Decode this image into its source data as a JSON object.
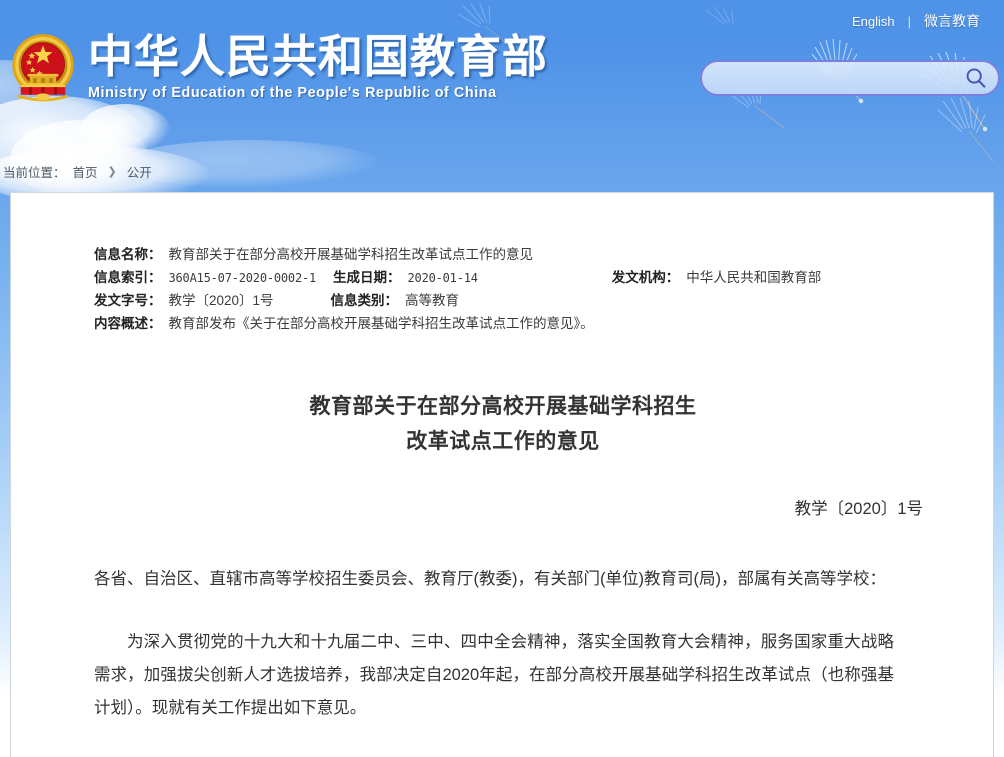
{
  "header": {
    "emblem_icon": "national-emblem-icon",
    "title_cn": "中华人民共和国教育部",
    "title_en": "Ministry of Education of the People's Republic of China",
    "links": [
      {
        "label": "English",
        "name": "english-link"
      },
      {
        "label": "微言教育",
        "name": "weiyan-jiaoyu-link"
      }
    ],
    "separator": "|",
    "search": {
      "value": "",
      "placeholder": "",
      "icon": "search-icon"
    }
  },
  "breadcrumb": {
    "label": "当前位置：",
    "items": [
      "首页",
      "公开"
    ],
    "arrow": "❯"
  },
  "meta": {
    "rows": [
      {
        "label": "信息名称：",
        "value": "教育部关于在部分高校开展基础学科招生改革试点工作的意见"
      },
      {
        "label": "信息索引：",
        "value": "360A15-07-2020-0002-1"
      },
      {
        "label": "生成日期：",
        "value": "2020-01-14"
      },
      {
        "label": "发文机构：",
        "value": "中华人民共和国教育部"
      },
      {
        "label": "发文字号：",
        "value": "教学〔2020〕1号"
      },
      {
        "label": "信息类别：",
        "value": "高等教育"
      },
      {
        "label": "内容概述：",
        "value": "教育部发布《关于在部分高校开展基础学科招生改革试点工作的意见》。"
      }
    ]
  },
  "document": {
    "title_line1": "教育部关于在部分高校开展基础学科招生",
    "title_line2": "改革试点工作的意见",
    "number": "教学〔2020〕1号",
    "recipients": "各省、自治区、直辖市高等学校招生委员会、教育厅(教委)，有关部门(单位)教育司(局)，部属有关高等学校：",
    "paragraph1": "为深入贯彻党的十九大和十九届二中、三中、四中全会精神，落实全国教育大会精神，服务国家重大战略需求，加强拔尖创新人才选拔培养，我部决定自2020年起，在部分高校开展基础学科招生改革试点（也称强基计划）。现就有关工作提出如下意见。"
  },
  "colors": {
    "sky_top": "#4f93e8",
    "sky_bottom": "#ffffff",
    "emblem_gold": "#e8b315",
    "emblem_red": "#d4121a",
    "search_border": "#7b7fe0",
    "panel_bg": "#ffffff",
    "panel_border": "#cfd6dd",
    "text_primary": "#333333",
    "breadcrumb_text": "#4d5a66"
  }
}
